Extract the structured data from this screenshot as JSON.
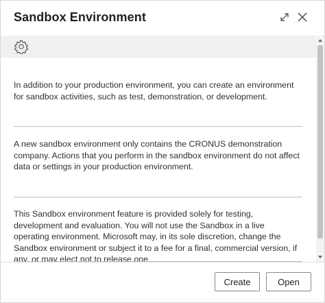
{
  "dialog": {
    "title": "Sandbox Environment",
    "icons": {
      "expand": "expand-icon",
      "close": "close-icon",
      "settings": "gear-icon"
    }
  },
  "content": {
    "paragraphs": [
      "In addition to your production environment, you can create an environment for sandbox activities, such as test, demonstration, or development.",
      "A new sandbox environment only contains the CRONUS demonstration company. Actions that you perform in the sandbox environment do not affect data or settings in your production environment.",
      "This Sandbox environment feature is provided solely for testing, development and evaluation. You will not use the Sandbox in a live operating environment. Microsoft may, in its sole discretion, change the Sandbox environment or subject it to a fee for a final, commercial version, if any, or may elect not to release one."
    ]
  },
  "buttons": {
    "create": "Create",
    "open": "Open"
  },
  "colors": {
    "toolbar_bg": "#f0f0f0",
    "divider": "#bdbdbd",
    "text": "#212121"
  }
}
